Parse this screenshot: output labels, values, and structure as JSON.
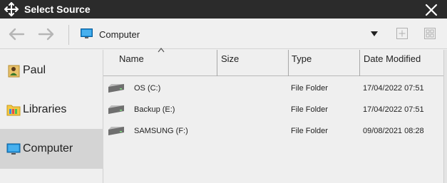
{
  "window": {
    "title": "Select Source"
  },
  "icons": {
    "app": "move-arrows-icon",
    "close": "close-icon",
    "back": "arrow-left-icon",
    "forward": "arrow-right-icon",
    "location": "monitor-icon",
    "dropdown": "triangle-down-icon",
    "new_folder": "plus-box-icon",
    "view": "grid-icon",
    "drive": "hard-drive-icon"
  },
  "toolbar": {
    "location": "Computer"
  },
  "sidebar": {
    "items": [
      {
        "label": "Paul",
        "icon": "user-icon",
        "selected": false
      },
      {
        "label": "Libraries",
        "icon": "library-folder-icon",
        "selected": false
      },
      {
        "label": "Computer",
        "icon": "monitor-icon",
        "selected": true
      }
    ]
  },
  "table": {
    "columns": [
      "Name",
      "Size",
      "Type",
      "Date Modified"
    ],
    "sort_column": "Name",
    "rows": [
      {
        "name": "OS (C:)",
        "size": "",
        "type": "File Folder",
        "date": "17/04/2022 07:51"
      },
      {
        "name": "Backup (E:)",
        "size": "",
        "type": "File Folder",
        "date": "17/04/2022 07:51"
      },
      {
        "name": "SAMSUNG (F:)",
        "size": "",
        "type": "File Folder",
        "date": "09/08/2021 08:28"
      }
    ]
  },
  "colors": {
    "titlebar": "#2b2b2b",
    "background": "#f0f0f0",
    "selected": "#d4d4d4",
    "monitor_blue": "#1e8fd8"
  }
}
